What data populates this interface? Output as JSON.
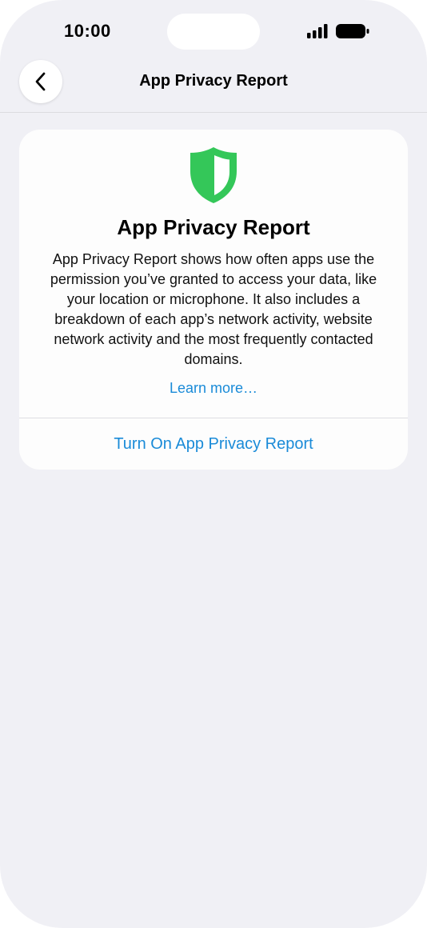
{
  "status_bar": {
    "time": "10:00",
    "icons": [
      "signal-icon",
      "battery-icon"
    ]
  },
  "nav": {
    "title": "App Privacy Report",
    "back_icon": "chevron-left-icon"
  },
  "card": {
    "icon": "shield-icon",
    "title": "App Privacy Report",
    "description": "App Privacy Report shows how often apps use the permission you’ve granted to access your data, like your location or microphone. It also includes a breakdown of each app’s network activity, website network activity and the most frequently contacted domains.",
    "learn_more": "Learn more…",
    "turn_on": "Turn On App Privacy Report"
  },
  "colors": {
    "background": "#f0f0f5",
    "card": "#fdfdfd",
    "accent": "#1a8bd8",
    "shield_green": "#34c759"
  }
}
